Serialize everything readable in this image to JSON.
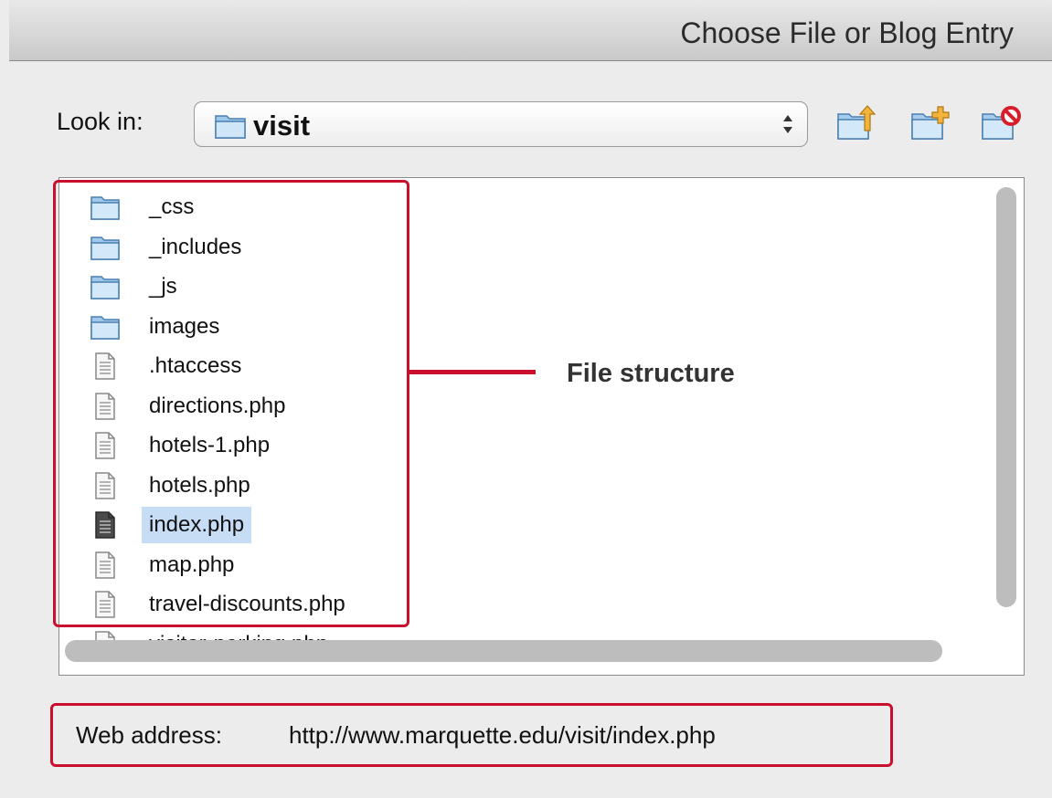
{
  "dialog": {
    "title": "Choose File or Blog Entry"
  },
  "look_in": {
    "label": "Look in:",
    "value": "visit"
  },
  "toolbar": {
    "icons": [
      "folder-up-icon",
      "new-folder-icon",
      "delete-folder-icon"
    ]
  },
  "files": [
    {
      "name": "_css",
      "type": "folder"
    },
    {
      "name": "_includes",
      "type": "folder"
    },
    {
      "name": "_js",
      "type": "folder"
    },
    {
      "name": "images",
      "type": "folder"
    },
    {
      "name": ".htaccess",
      "type": "file"
    },
    {
      "name": "directions.php",
      "type": "file"
    },
    {
      "name": "hotels-1.php",
      "type": "file"
    },
    {
      "name": "hotels.php",
      "type": "file"
    },
    {
      "name": "index.php",
      "type": "file",
      "selected": true
    },
    {
      "name": "map.php",
      "type": "file"
    },
    {
      "name": "travel-discounts.php",
      "type": "file"
    },
    {
      "name": "visitor-parking.php",
      "type": "file"
    }
  ],
  "annotation": {
    "label": "File structure",
    "color": "#c8102e"
  },
  "web_address": {
    "label": "Web address:",
    "value": "http://www.marquette.edu/visit/index.php"
  },
  "colors": {
    "selection": "#c7dcf5",
    "accent": "#c8102e"
  }
}
